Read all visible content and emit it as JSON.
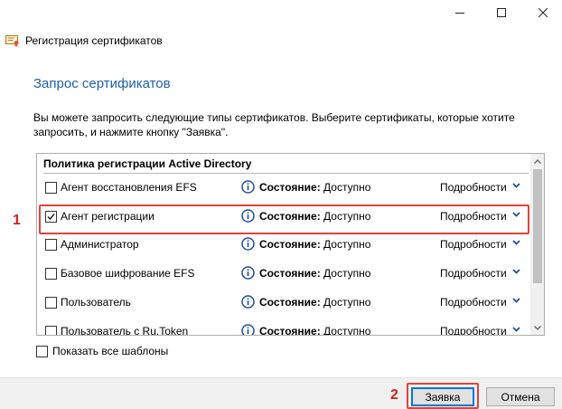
{
  "window": {
    "title": "Регистрация сертификатов",
    "controls": [
      "minimize-icon",
      "maximize-icon",
      "close-icon"
    ]
  },
  "page": {
    "title": "Запрос сертификатов",
    "description": "Вы можете запросить следующие типы сертификатов. Выберите сертификаты, которые хотите запросить, и нажмите кнопку \"Заявка\"."
  },
  "list": {
    "group_header": "Политика регистрации Active Directory",
    "items": [
      {
        "label": "Агент восстановления EFS",
        "checked": false,
        "status_label": "Состояние:",
        "status_value": "Доступно",
        "details": "Подробности"
      },
      {
        "label": "Агент регистрации",
        "checked": true,
        "status_label": "Состояние:",
        "status_value": "Доступно",
        "details": "Подробности"
      },
      {
        "label": "Администратор",
        "checked": false,
        "status_label": "Состояние:",
        "status_value": "Доступно",
        "details": "Подробности"
      },
      {
        "label": "Базовое шифрование EFS",
        "checked": false,
        "status_label": "Состояние:",
        "status_value": "Доступно",
        "details": "Подробности"
      },
      {
        "label": "Пользователь",
        "checked": false,
        "status_label": "Состояние:",
        "status_value": "Доступно",
        "details": "Подробности"
      },
      {
        "label": "Пользователь с Ru.Token",
        "checked": false,
        "status_label": "Состояние:",
        "status_value": "Доступно",
        "details": "Подробности"
      }
    ]
  },
  "show_all_templates": {
    "label": "Показать все шаблоны",
    "checked": false
  },
  "annotations": {
    "marker_1": "1",
    "marker_2": "2"
  },
  "buttons": {
    "submit": "Заявка",
    "cancel": "Отмена"
  },
  "colors": {
    "title_blue": "#1f5fa8",
    "highlight_red": "#e2423d",
    "marker_red": "#d02020",
    "focus_blue": "#0078d7"
  }
}
